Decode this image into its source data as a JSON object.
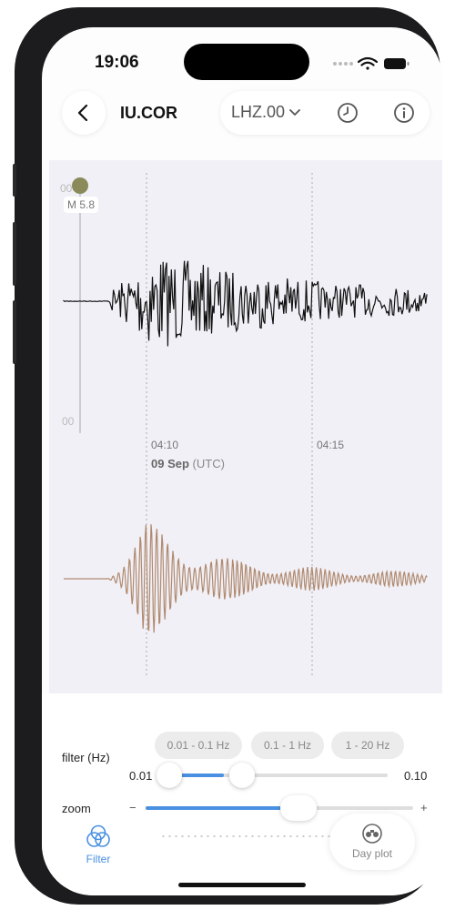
{
  "status_bar": {
    "time": "19:06"
  },
  "nav": {
    "station": "IU.COR",
    "channel": "LHZ.00",
    "back_icon": "chevron-left-icon",
    "history_icon": "clock-icon",
    "info_icon": "info-icon"
  },
  "plot": {
    "event_marker": "M 5.8",
    "axis_top_cut": "00",
    "axis_bottom_cut": "00",
    "time_labels": [
      "04:10",
      "04:15"
    ],
    "date": "09 Sep",
    "timezone": "(UTC)",
    "raw_trace_color": "#111111",
    "filtered_trace_color": "#b08a70",
    "marker_color": "#8a8a5a"
  },
  "filter": {
    "label": "filter (Hz)",
    "presets": [
      "0.01 - 0.1 Hz",
      "0.1 - 1 Hz",
      "1 - 20 Hz"
    ],
    "min_value": "0.01",
    "max_value": "0.10",
    "range_low_fraction": 0.0,
    "range_high_fraction": 0.25
  },
  "zoom": {
    "label": "zoom",
    "minus": "−",
    "plus": "+",
    "level_fraction": 0.57
  },
  "bottom_bar": {
    "filter_label": "Filter",
    "day_plot_label": "Day plot"
  },
  "colors": {
    "accent": "#4a90e2"
  }
}
